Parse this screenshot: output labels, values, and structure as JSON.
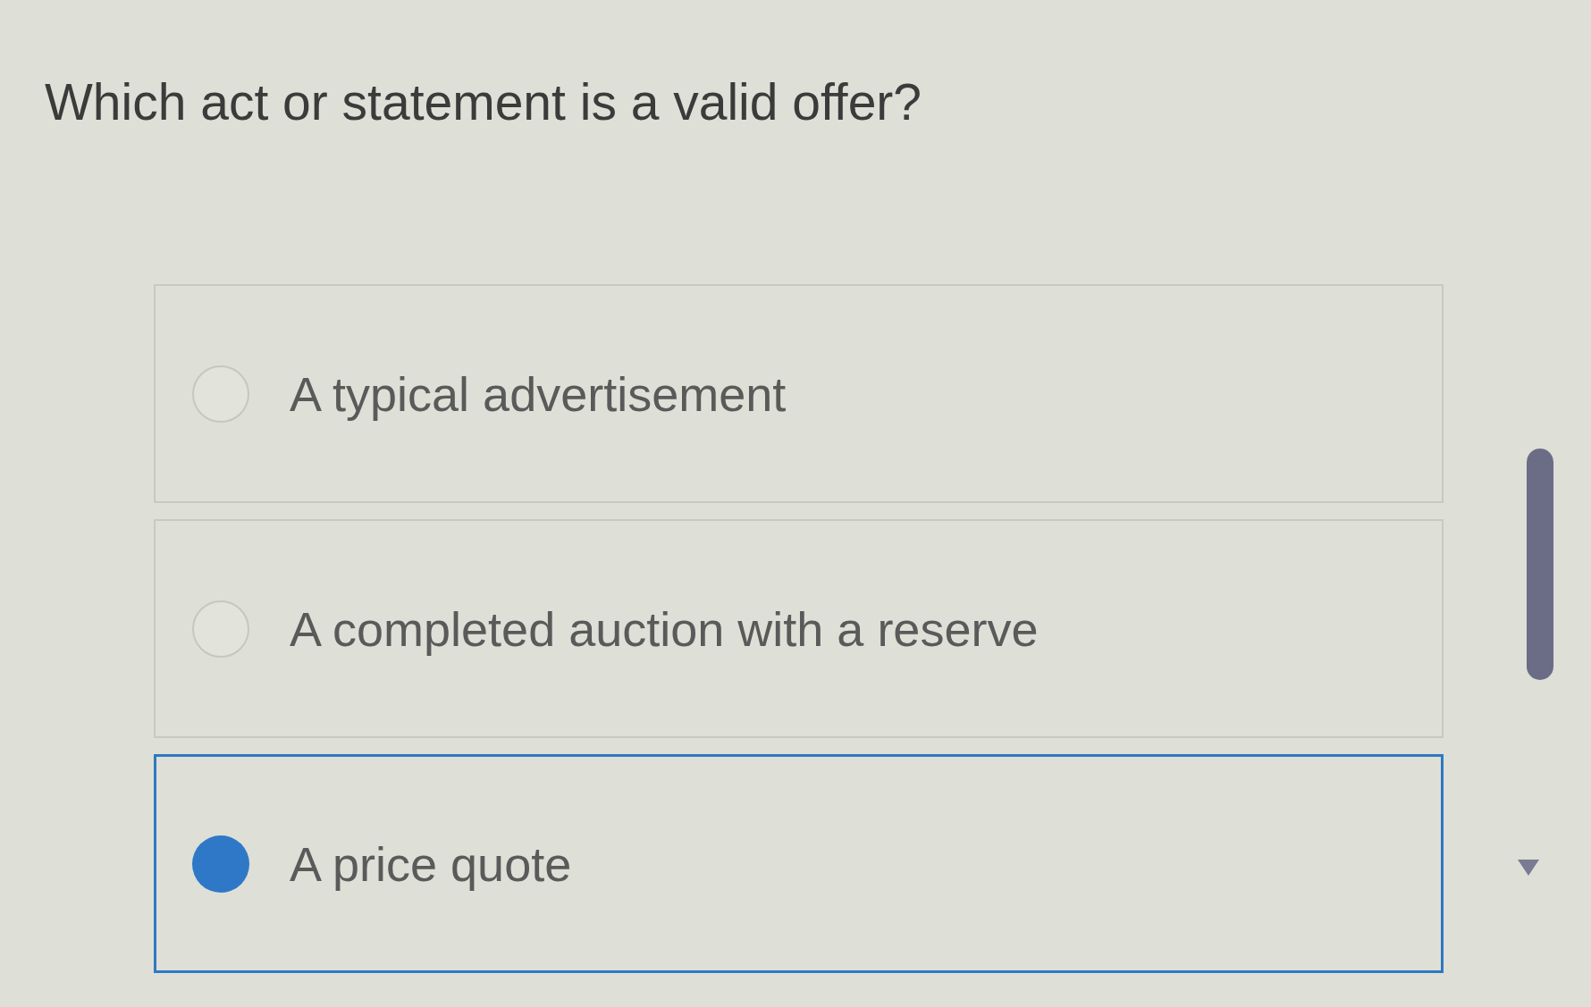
{
  "question": "Which act or statement is a valid offer?",
  "options": [
    {
      "label": "A typical advertisement",
      "selected": false
    },
    {
      "label": "A completed auction with a reserve",
      "selected": false
    },
    {
      "label": "A price quote",
      "selected": true
    }
  ]
}
